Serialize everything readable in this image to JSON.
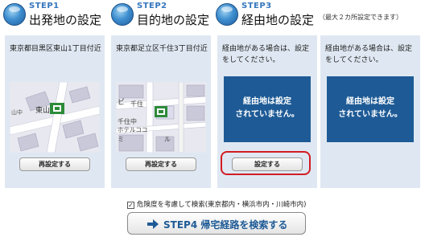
{
  "steps": [
    {
      "step": "STEP1",
      "title": "出発地の設定",
      "address": "東京都目黒区東山1丁目付近",
      "button": "再設定する"
    },
    {
      "step": "STEP2",
      "title": "目的地の設定",
      "address": "東京都足立区千住3丁目付近",
      "button": "再設定する"
    },
    {
      "step": "STEP3",
      "title": "経由地の設定",
      "address": "経由地がある場合は、設定をしてください。",
      "message_line1": "経由地は設定",
      "message_line2": "されていません。",
      "button": "設定する"
    },
    {
      "address": "経由地がある場合は、設定をしてください。",
      "message_line1": "経由地は設定",
      "message_line2": "されていません。"
    }
  ],
  "note": "（最大２カ所設定できます）",
  "map1": {
    "label_area": "東山",
    "label_road": "山中"
  },
  "map2": {
    "label_a": "ビ",
    "label_b": "千住",
    "label_c": "千住中",
    "label_d": "ホテルココ",
    "label_e": "ミ",
    "label_f": "ル"
  },
  "danger_option": {
    "checkmark": "✓",
    "label": "危険度を考慮して検索(東京都内・横浜市内・川崎市内)",
    "checked": true
  },
  "search_button": {
    "label": "STEP4 帰宅経路を検索する"
  },
  "colors": {
    "accent": "#1e5b96",
    "panel": "#dfe8f2",
    "highlight": "#d11c24"
  }
}
